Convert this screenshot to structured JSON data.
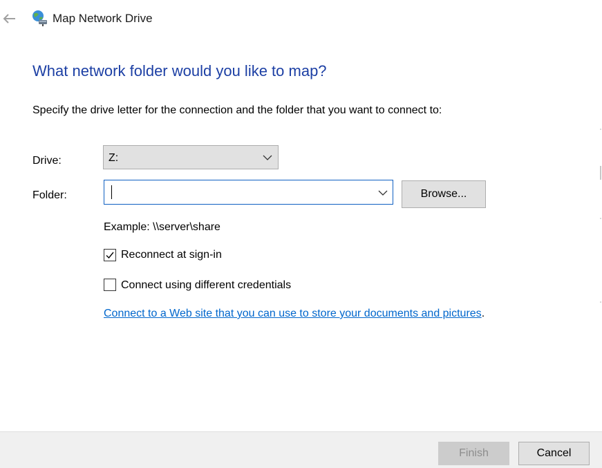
{
  "window": {
    "title": "Map Network Drive"
  },
  "heading": "What network folder would you like to map?",
  "instructions": "Specify the drive letter for the connection and the folder that you want to connect to:",
  "drive": {
    "label": "Drive:",
    "selected": "Z:"
  },
  "folder": {
    "label": "Folder:",
    "value": "",
    "browse_label": "Browse..."
  },
  "example": "Example: \\\\server\\share",
  "options": {
    "reconnect": {
      "label": "Reconnect at sign-in",
      "checked": true
    },
    "credentials": {
      "label": "Connect using different credentials",
      "checked": false
    }
  },
  "web_link": {
    "text": "Connect to a Web site that you can use to store your documents and pictures",
    "suffix": "."
  },
  "footer": {
    "finish_label": "Finish",
    "cancel_label": "Cancel"
  },
  "icons": {
    "back": "back-arrow-icon",
    "title": "network-drive-icon"
  },
  "colors": {
    "heading": "#1c3fa4",
    "link": "#0066cc",
    "focus_border": "#0e5fc2"
  }
}
